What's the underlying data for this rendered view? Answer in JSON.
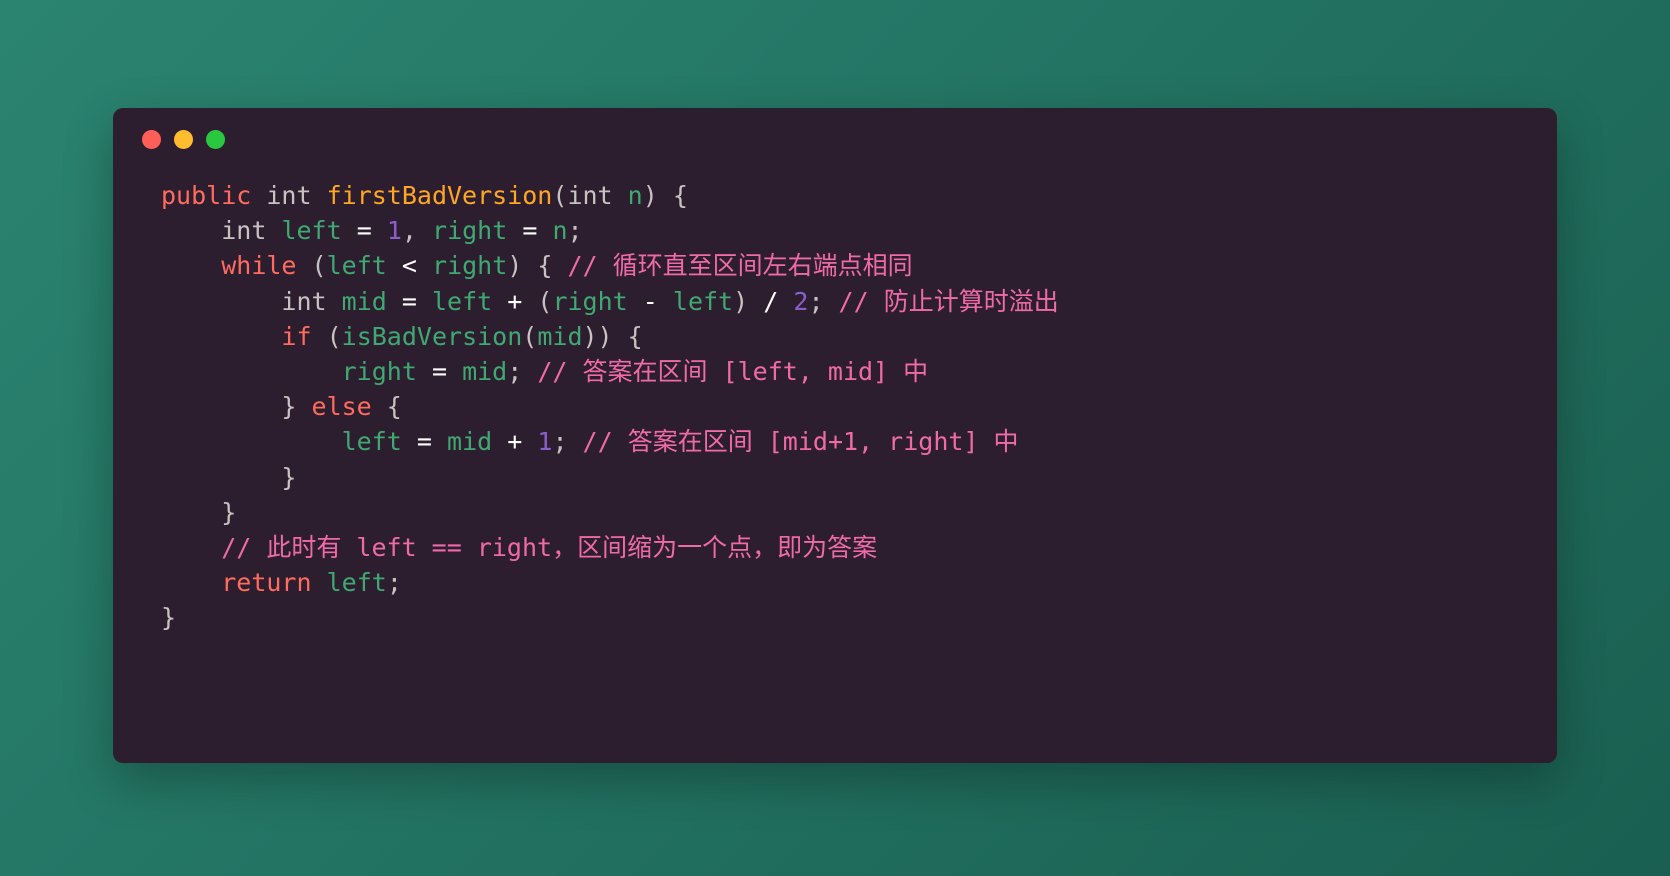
{
  "window": {
    "controls": [
      {
        "name": "close",
        "color": "#ff5f57"
      },
      {
        "name": "minimize",
        "color": "#febc2e"
      },
      {
        "name": "maximize",
        "color": "#28c840"
      }
    ]
  },
  "theme": {
    "page_background_start": "#2b8470",
    "page_background_end": "#1a5f51",
    "card_background": "#2d1e2f",
    "keyword": "#ff6b5e",
    "type": "#c8c3c0",
    "function": "#ffa724",
    "variable": "#3fa971",
    "number": "#8b5fc9",
    "operator": "#ffffff",
    "punctuation": "#c8c3c0",
    "comment": "#ef6ba8"
  },
  "code": {
    "language": "java",
    "lines": [
      {
        "indent": "",
        "tokens": [
          {
            "t": "public",
            "c": "kw"
          },
          {
            "t": " ",
            "c": "punc"
          },
          {
            "t": "int",
            "c": "type"
          },
          {
            "t": " ",
            "c": "punc"
          },
          {
            "t": "firstBadVersion",
            "c": "fn"
          },
          {
            "t": "(",
            "c": "punc"
          },
          {
            "t": "int",
            "c": "type"
          },
          {
            "t": " ",
            "c": "punc"
          },
          {
            "t": "n",
            "c": "var"
          },
          {
            "t": ") {",
            "c": "punc"
          }
        ]
      },
      {
        "indent": "    ",
        "tokens": [
          {
            "t": "int",
            "c": "type"
          },
          {
            "t": " ",
            "c": "punc"
          },
          {
            "t": "left",
            "c": "var"
          },
          {
            "t": " ",
            "c": "punc"
          },
          {
            "t": "=",
            "c": "op"
          },
          {
            "t": " ",
            "c": "punc"
          },
          {
            "t": "1",
            "c": "num"
          },
          {
            "t": ", ",
            "c": "punc"
          },
          {
            "t": "right",
            "c": "var"
          },
          {
            "t": " ",
            "c": "punc"
          },
          {
            "t": "=",
            "c": "op"
          },
          {
            "t": " ",
            "c": "punc"
          },
          {
            "t": "n",
            "c": "var"
          },
          {
            "t": ";",
            "c": "punc"
          }
        ]
      },
      {
        "indent": "    ",
        "tokens": [
          {
            "t": "while",
            "c": "kw"
          },
          {
            "t": " ",
            "c": "punc"
          },
          {
            "t": "(",
            "c": "punc"
          },
          {
            "t": "left",
            "c": "var"
          },
          {
            "t": " ",
            "c": "punc"
          },
          {
            "t": "<",
            "c": "op"
          },
          {
            "t": " ",
            "c": "punc"
          },
          {
            "t": "right",
            "c": "var"
          },
          {
            "t": ") { ",
            "c": "punc"
          },
          {
            "t": "// 循环直至区间左右端点相同",
            "c": "cmt"
          }
        ]
      },
      {
        "indent": "        ",
        "tokens": [
          {
            "t": "int",
            "c": "type"
          },
          {
            "t": " ",
            "c": "punc"
          },
          {
            "t": "mid",
            "c": "var"
          },
          {
            "t": " ",
            "c": "punc"
          },
          {
            "t": "=",
            "c": "op"
          },
          {
            "t": " ",
            "c": "punc"
          },
          {
            "t": "left",
            "c": "var"
          },
          {
            "t": " ",
            "c": "punc"
          },
          {
            "t": "+",
            "c": "op"
          },
          {
            "t": " ",
            "c": "punc"
          },
          {
            "t": "(",
            "c": "punc"
          },
          {
            "t": "right",
            "c": "var"
          },
          {
            "t": " ",
            "c": "punc"
          },
          {
            "t": "-",
            "c": "op"
          },
          {
            "t": " ",
            "c": "punc"
          },
          {
            "t": "left",
            "c": "var"
          },
          {
            "t": ")",
            "c": "punc"
          },
          {
            "t": " ",
            "c": "punc"
          },
          {
            "t": "/",
            "c": "op"
          },
          {
            "t": " ",
            "c": "punc"
          },
          {
            "t": "2",
            "c": "num"
          },
          {
            "t": "; ",
            "c": "punc"
          },
          {
            "t": "// 防止计算时溢出",
            "c": "cmt"
          }
        ]
      },
      {
        "indent": "        ",
        "tokens": [
          {
            "t": "if",
            "c": "kw"
          },
          {
            "t": " ",
            "c": "punc"
          },
          {
            "t": "(",
            "c": "punc"
          },
          {
            "t": "isBadVersion",
            "c": "var"
          },
          {
            "t": "(",
            "c": "punc"
          },
          {
            "t": "mid",
            "c": "var"
          },
          {
            "t": ")) {",
            "c": "punc"
          }
        ]
      },
      {
        "indent": "            ",
        "tokens": [
          {
            "t": "right",
            "c": "var"
          },
          {
            "t": " ",
            "c": "punc"
          },
          {
            "t": "=",
            "c": "op"
          },
          {
            "t": " ",
            "c": "punc"
          },
          {
            "t": "mid",
            "c": "var"
          },
          {
            "t": "; ",
            "c": "punc"
          },
          {
            "t": "// 答案在区间 [left, mid] 中",
            "c": "cmt"
          }
        ]
      },
      {
        "indent": "        ",
        "tokens": [
          {
            "t": "} ",
            "c": "punc"
          },
          {
            "t": "else",
            "c": "kw"
          },
          {
            "t": " {",
            "c": "punc"
          }
        ]
      },
      {
        "indent": "            ",
        "tokens": [
          {
            "t": "left",
            "c": "var"
          },
          {
            "t": " ",
            "c": "punc"
          },
          {
            "t": "=",
            "c": "op"
          },
          {
            "t": " ",
            "c": "punc"
          },
          {
            "t": "mid",
            "c": "var"
          },
          {
            "t": " ",
            "c": "punc"
          },
          {
            "t": "+",
            "c": "op"
          },
          {
            "t": " ",
            "c": "punc"
          },
          {
            "t": "1",
            "c": "num"
          },
          {
            "t": "; ",
            "c": "punc"
          },
          {
            "t": "// 答案在区间 [mid+1, right] 中",
            "c": "cmt"
          }
        ]
      },
      {
        "indent": "        ",
        "tokens": [
          {
            "t": "}",
            "c": "punc"
          }
        ]
      },
      {
        "indent": "    ",
        "tokens": [
          {
            "t": "}",
            "c": "punc"
          }
        ]
      },
      {
        "indent": "    ",
        "tokens": [
          {
            "t": "// 此时有 left == right，区间缩为一个点，即为答案",
            "c": "cmt"
          }
        ]
      },
      {
        "indent": "    ",
        "tokens": [
          {
            "t": "return",
            "c": "kw"
          },
          {
            "t": " ",
            "c": "punc"
          },
          {
            "t": "left",
            "c": "var"
          },
          {
            "t": ";",
            "c": "punc"
          }
        ]
      },
      {
        "indent": "",
        "tokens": [
          {
            "t": "}",
            "c": "punc"
          }
        ]
      }
    ]
  }
}
